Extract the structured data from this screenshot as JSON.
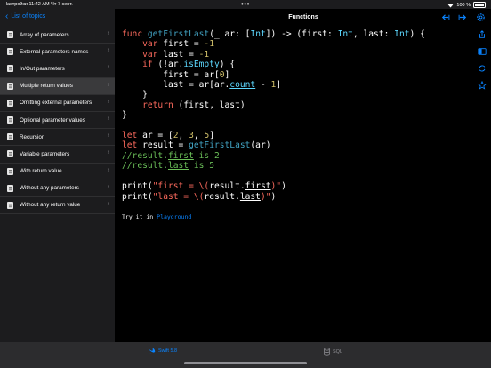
{
  "status": {
    "time": "11:42 AM",
    "carrier": "Настройки",
    "date": "Чт 7 сент.",
    "dots": "•••",
    "battery": "100 %"
  },
  "nav": {
    "back_label": "List of topics",
    "title": "Functions"
  },
  "sidebar": {
    "items": [
      {
        "label": "Array of parameters"
      },
      {
        "label": "External parameters names"
      },
      {
        "label": "In/Out parameters"
      },
      {
        "label": "Multiple return values"
      },
      {
        "label": "Omitting external parameters"
      },
      {
        "label": "Optional parameter values"
      },
      {
        "label": "Recursion"
      },
      {
        "label": "Variable parameters"
      },
      {
        "label": "With return value"
      },
      {
        "label": "Without any parameters"
      },
      {
        "label": "Without any return value"
      }
    ],
    "selected_index": 3
  },
  "code": {
    "try_prefix": "Try it in",
    "try_link": "Playground"
  },
  "tabs": [
    {
      "label": "Swift 5.8"
    },
    {
      "label": "SQL"
    }
  ],
  "colors": {
    "accent": "#0a84ff",
    "keyword": "#fc6a5d",
    "type": "#5dd8ff",
    "number": "#d0bf69",
    "comment": "#6bbf59"
  }
}
